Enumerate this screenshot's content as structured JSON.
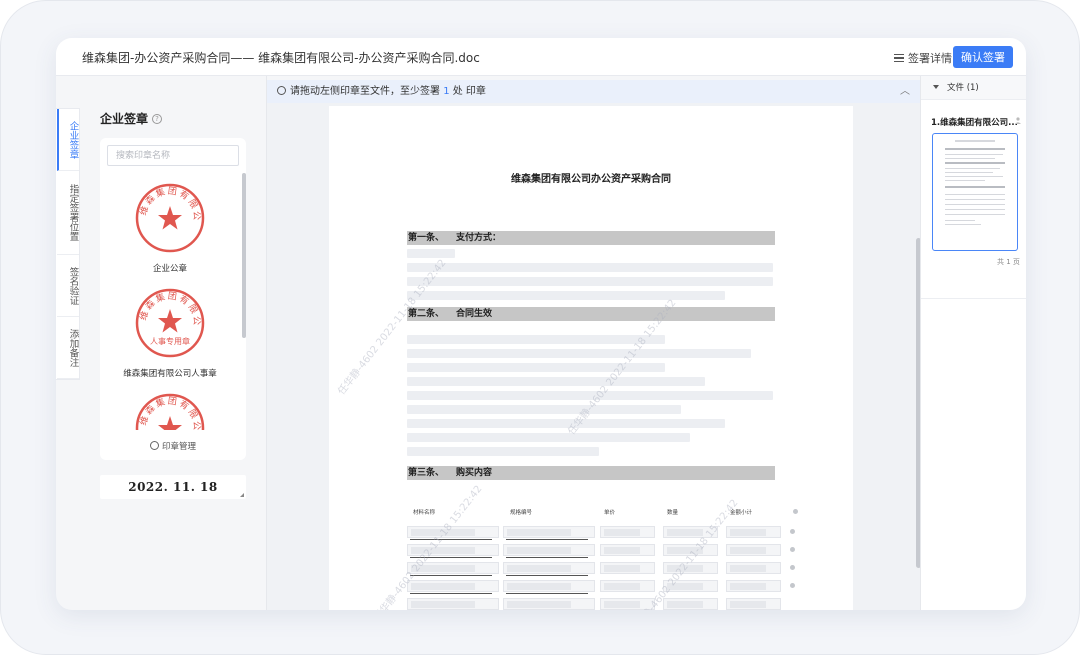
{
  "header": {
    "title": "维森集团-办公资产采购合同—— 维森集团有限公司-办公资产采购合同.doc",
    "details_label": "签署详情",
    "confirm_label": "确认签署"
  },
  "side_tabs": [
    {
      "label": "企业签章",
      "active": true
    },
    {
      "label": "指定签署位置",
      "active": false
    },
    {
      "label": "签名验证",
      "active": false
    },
    {
      "label": "添加备注",
      "active": false
    }
  ],
  "seal_panel": {
    "title": "企业签章",
    "search_placeholder": "搜索印章名称",
    "seals": [
      {
        "name": "企业公章",
        "ring_text": "维森集团有限公司",
        "bottom_text": ""
      },
      {
        "name": "维森集团有限公司人事章",
        "ring_text": "维森集团有限公司",
        "bottom_text": "人事专用章"
      },
      {
        "name": "",
        "ring_text": "维森集团有限公司",
        "bottom_text": ""
      }
    ],
    "manage_label": "印章管理",
    "date_stamp": "2022. 11. 18"
  },
  "notice": {
    "prefix": "请拖动左侧印章至文件，至少签署",
    "count": "1",
    "suffix": "处 印章"
  },
  "document": {
    "title": "维森集团有限公司办公资产采购合同",
    "sections": [
      {
        "num": "第一条、",
        "title": "支付方式："
      },
      {
        "num": "第二条、",
        "title": "合同生效"
      },
      {
        "num": "第三条、",
        "title": "购买内容"
      }
    ],
    "table_headers": [
      "材料名称",
      "规格编号",
      "单价",
      "数量",
      "金额小计"
    ],
    "watermark": "任华静-4602 2022-11-18 15:22:42"
  },
  "files_panel": {
    "header": "文件 (1)",
    "file_name": "1.维森集团有限公司...",
    "page_count": "共 1 页"
  },
  "colors": {
    "accent": "#3b7cf6",
    "seal_red": "#e0574f"
  }
}
